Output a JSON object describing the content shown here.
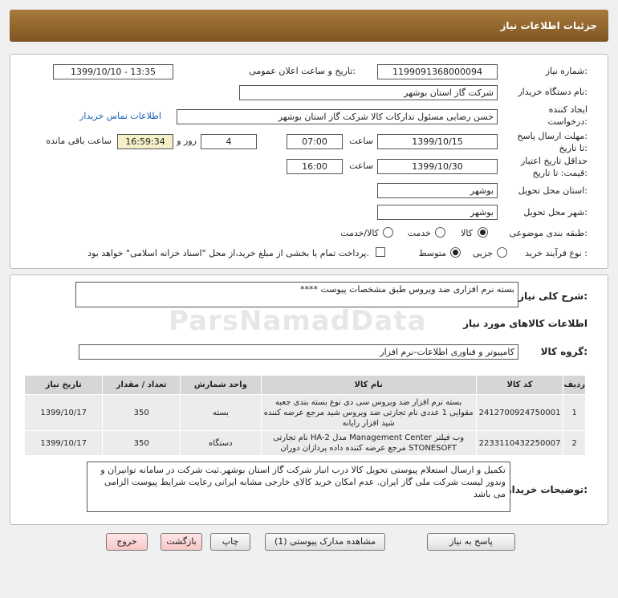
{
  "header": {
    "title": "جزئیات اطلاعات نیاز"
  },
  "form": {
    "need_number_label": "شماره نیاز:",
    "need_number": "1199091368000094",
    "announce_label": "تاریخ و ساعت اعلان عمومی:",
    "announce_value": "1399/10/10 - 13:35",
    "buyer_org_label": "نام دستگاه خریدار:",
    "buyer_org": "شرکت گاز استان بوشهر",
    "requester_label_1": "ایجاد کننده",
    "requester_label_2": "درخواست:",
    "requester": "حسن رضایی مسئول تدارکات کالا شرکت گاز استان بوشهر",
    "contact_link": "اطلاعات تماس خریدار",
    "deadline_label_1": "مهلت ارسال پاسخ:",
    "deadline_label_2": "تا تاریخ:",
    "deadline_date": "1399/10/15",
    "time_label": "ساعت",
    "deadline_time": "07:00",
    "days_value": "4",
    "days_label": "روز و",
    "remaining_time": "16:59:34",
    "remaining_label": "ساعت باقی مانده",
    "validity_label_1": "حداقل تاریخ اعتبار",
    "validity_label_2": "قیمت: تا تاریخ:",
    "validity_date": "1399/10/30",
    "validity_time_label": "ساعت",
    "validity_time": "16:00",
    "province_label": "استان محل تحویل:",
    "province": "بوشهر",
    "city_label": "شهر محل تحویل:",
    "city": "بوشهر",
    "category_label": "طبقه بندی موضوعی:",
    "category_options": [
      "کالا",
      "خدمت",
      "کالا/خدمت"
    ],
    "category_selected": "کالا",
    "process_label": "نوع فرآیند خرید :",
    "process_options": [
      "جزیی",
      "متوسط"
    ],
    "process_selected": "متوسط",
    "payment_note": "پرداخت تمام یا بخشی از مبلغ خرید،از محل \"اسناد خزانه اسلامی\" خواهد بود."
  },
  "summary": {
    "label": "شرح کلی نیاز:",
    "value": "بسته نرم افزاری ضد ویروس طبق مشخصات پیوست ****",
    "goods_info_title": "اطلاعات کالاهای مورد نیاز",
    "group_label": "گروه کالا:",
    "group_value": "کامپیوتر و فناوری اطلاعات-نرم افزار"
  },
  "table": {
    "headers": [
      "ردیف",
      "کد کالا",
      "نام کالا",
      "واحد شمارش",
      "تعداد / مقدار",
      "تاریخ نیاز"
    ],
    "rows": [
      {
        "row": "1",
        "code": "2412700924750001",
        "name": "بسته نرم افزار ضد ویروس سی دی نوع بسته بندی جعبه مقوایی 1 عددی نام تجارتی ضد ویروس شید مرجع عرضه کننده شید افزار رایانه",
        "unit": "بسته",
        "qty": "350",
        "date": "1399/10/17"
      },
      {
        "row": "2",
        "code": "2233110432250007",
        "name": "وب فیلتر Management Center مدل HA-2 نام تجارتی STONESOFT مرجع عرضه کننده داده پردازان دوران",
        "unit": "دستگاه",
        "qty": "350",
        "date": "1399/10/17"
      }
    ]
  },
  "buyer_notes": {
    "label": "توضیحات خریدار:",
    "value": "تکمیل و ارسال استعلام پیوستی تحویل کالا درب انبار شرکت گاز استان بوشهر.ثبت شرکت در سامانه توانیران و وندور لیست شرکت ملی گاز ایران. عدم امکان خرید کالای خارجی مشابه ایرانی رعایت شرایط پیوست الزامی می باشد"
  },
  "buttons": {
    "reply": "پاسخ به نیاز",
    "attachments": "مشاهده مدارک پیوستی (1)",
    "print": "چاپ",
    "back": "بازگشت",
    "exit": "خروج"
  },
  "watermark": "ParsNamadData"
}
